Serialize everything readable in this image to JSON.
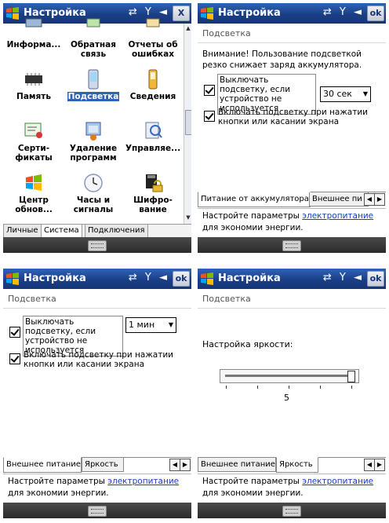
{
  "app_title": "Настройка",
  "ok_label": "ok",
  "close_label": "X",
  "status_icons": "⇄ Y ◄",
  "screen1": {
    "items": [
      {
        "label": "Информа...",
        "icon": "info-icon"
      },
      {
        "label": "Обратная связь",
        "icon": "feedback-icon"
      },
      {
        "label": "Отчеты об ошибках",
        "icon": "error-report-icon"
      },
      {
        "label": "Память",
        "icon": "memory-chip-icon"
      },
      {
        "label": "Подсветка",
        "icon": "backlight-icon"
      },
      {
        "label": "Сведения",
        "icon": "about-icon"
      },
      {
        "label": "Серти-фикаты",
        "icon": "certificate-icon"
      },
      {
        "label": "Удаление программ",
        "icon": "remove-programs-icon"
      },
      {
        "label": "Управляе...",
        "icon": "managed-icon"
      },
      {
        "label": "Центр обнов...",
        "icon": "update-center-icon"
      },
      {
        "label": "Часы и сигналы",
        "icon": "clock-icon"
      },
      {
        "label": "Шифро-вание",
        "icon": "encryption-icon"
      }
    ],
    "tabs": [
      "Личные",
      "Система",
      "Подключения"
    ],
    "active_tab": "Система"
  },
  "backlight": {
    "header": "Подсветка",
    "warning": "Внимание! Пользование подсветкой резко снижает заряд аккумулятора.",
    "battery": {
      "chk1": "Выключать подсветку, если устройство не используется",
      "combo": "30 сек",
      "chk2": "Включать подсветку при нажатии кнопки или касании экрана"
    },
    "external": {
      "chk1": "Выключать подсветку, если устройство не используется",
      "combo": "1 мин",
      "chk2": "Включать подсветку при нажатии кнопки или касании экрана"
    },
    "brightness": {
      "label": "Настройка яркости:",
      "value": "5",
      "level_fraction": 1.0
    },
    "tabs": {
      "battery": "Питание от аккумулятора",
      "external": "Внешнее питание",
      "external_cut": "Внешнее пи",
      "brightness": "Яркость"
    },
    "footer_prefix": "Настройте параметры",
    "footer_link": "электропитание",
    "footer_suffix": "для экономии энергии."
  }
}
